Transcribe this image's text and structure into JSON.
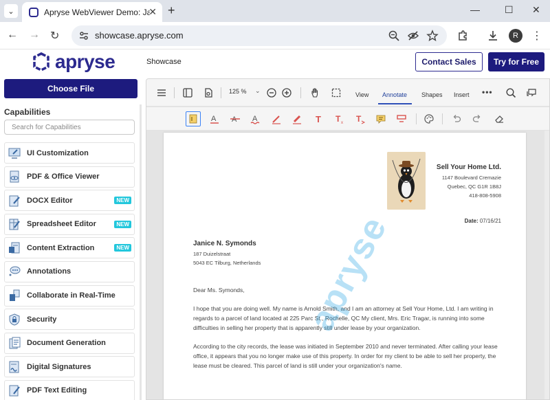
{
  "browser": {
    "tab_title": "Apryse WebViewer Demo: JavaScript PDF Viewer",
    "url": "showcase.apryse.com",
    "profile_initial": "R",
    "icons": [
      "tab-search-icon",
      "new-tab-icon",
      "minimize-icon",
      "maximize-icon",
      "close-icon",
      "back-icon",
      "forward-icon",
      "reload-icon",
      "site-info-icon",
      "zoom-icon",
      "eye-off-icon",
      "star-icon",
      "extensions-icon",
      "download-icon",
      "more-icon"
    ]
  },
  "site": {
    "logo_text": "apryse",
    "showcase_link": "Showcase",
    "contact_sales": "Contact Sales",
    "try_free": "Try for Free",
    "brand_color": "#1d1b7e",
    "badge_color": "#22c7dc"
  },
  "left_panel": {
    "choose_file": "Choose File",
    "capabilities_title": "Capabilities",
    "search_placeholder": "Search for Capabilities",
    "items": [
      {
        "label": "UI Customization",
        "badge": ""
      },
      {
        "label": "PDF & Office Viewer",
        "badge": ""
      },
      {
        "label": "DOCX Editor",
        "badge": "NEW"
      },
      {
        "label": "Spreadsheet Editor",
        "badge": "NEW"
      },
      {
        "label": "Content Extraction",
        "badge": "NEW"
      },
      {
        "label": "Annotations",
        "badge": ""
      },
      {
        "label": "Collaborate in Real-Time",
        "badge": ""
      },
      {
        "label": "Security",
        "badge": ""
      },
      {
        "label": "Document Generation",
        "badge": ""
      },
      {
        "label": "Digital Signatures",
        "badge": ""
      },
      {
        "label": "PDF Text Editing",
        "badge": ""
      }
    ]
  },
  "viewer": {
    "zoom": "125 %",
    "tabs": [
      "View",
      "Annotate",
      "Shapes",
      "Insert"
    ],
    "active_tab": "Annotate"
  },
  "document": {
    "company_name": "Sell Your Home Ltd.",
    "company_lines": [
      "1147 Boulevard Cremazie",
      "Quebec, QC G1R 1B8J",
      "418-808-5908"
    ],
    "date_label": "Date:",
    "date_value": "07/16/21",
    "recipient_name": "Janice N. Symonds",
    "recipient_lines": [
      "187 Duizelstraat",
      "5043 EC Tilburg, Netherlands"
    ],
    "salutation": "Dear Ms. Symonds,",
    "paragraph1": "I hope that you are doing well. My name is Arnold Smith, and I am an attorney at Sell Your Home, Ltd. I am writing in regards to a parcel of land located at 225 Parc St., Rochelle, QC  My client, Mrs. Eric Tragar, is running into some difficulties in selling her property that is apparently still under lease by your organization.",
    "paragraph2": "According to the city records, the lease was initiated in September 2010 and never terminated. After calling your lease office, it appears that you no longer make use of this property. In order for my client to be able to sell her property, the lease must be cleared. This parcel of land is still under your organization's name.",
    "watermark": "apryse"
  }
}
